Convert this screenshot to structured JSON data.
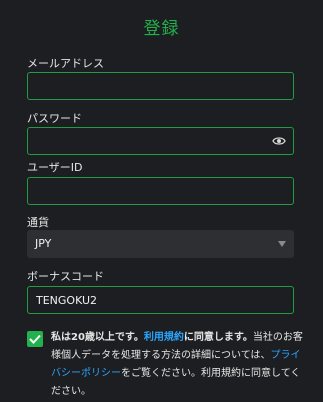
{
  "title": "登録",
  "fields": {
    "email": {
      "label": "メールアドレス",
      "value": ""
    },
    "password": {
      "label": "パスワード",
      "value": ""
    },
    "user_id": {
      "label": "ユーザーID",
      "value": ""
    },
    "currency": {
      "label": "通貨",
      "value": "JPY"
    },
    "bonus_code": {
      "label": "ボーナスコード",
      "value": "TENGOKU2"
    }
  },
  "consent": {
    "checked": true,
    "part1": "私は20歳以上です。",
    "link_terms": "利用規約",
    "part2": "に同意します。",
    "part3": "当社のお客様個人データを処理する方法の詳細については、",
    "link_privacy": "プライバシーポリシー",
    "part4": "をご覧ください。利用規約に同意してください。"
  },
  "colors": {
    "accent": "#22b14c",
    "border": "#1f9d44",
    "background": "#1c1e21",
    "link": "#2aa6ff"
  },
  "icons": {
    "password_toggle": "eye-icon",
    "currency_dropdown": "chevron-down-icon",
    "checkbox": "check-icon"
  }
}
